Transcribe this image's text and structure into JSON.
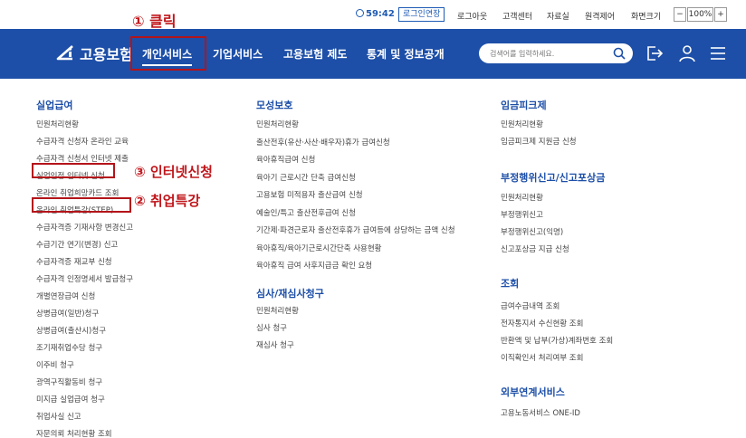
{
  "topbar": {
    "timer": "59:42",
    "extend": "로그인연장",
    "logout": "로그아웃",
    "support": "고객센터",
    "library": "자료실",
    "remote": "원격제어",
    "zoom_label": "화면크기",
    "zoom_minus": "−",
    "zoom_value": "100%",
    "zoom_plus": "+"
  },
  "nav": {
    "logo": "고용보험",
    "items": [
      "개인서비스",
      "기업서비스",
      "고용보험 제도",
      "통계 및 정보공개"
    ],
    "search_placeholder": "검색어를 입력하세요."
  },
  "annotations": {
    "a1": "① 클릭",
    "a2": "② 취업특강",
    "a3": "③ 인터넷신청"
  },
  "columns": {
    "c1": {
      "title": "실업급여",
      "items": [
        "민원처리현황",
        "수급자격 신청자 온라인 교육",
        "수급자격 신청서 인터넷 제출",
        "실업인정 인터넷 신청",
        "온라인 취업희망카드 조회",
        "온라인 취업특강(STEP)",
        "수급자격증 기재사항 변경신고",
        "수급기간 연기(변경) 신고",
        "수급자격증 재교부 신청",
        "수급자격 인정명세서 발급청구",
        "개별연장급여 신청",
        "상병급여(일반)청구",
        "상병급여(출산시)청구",
        "조기재취업수당 청구",
        "이주비 청구",
        "광역구직활동비 청구",
        "미지급 실업급여 청구",
        "취업사실 신고",
        "자문의뢰 처리현황 조회"
      ]
    },
    "c2": {
      "title": "모성보호",
      "items": [
        "민원처리현황",
        "출산전후(유산·사산·배우자)휴가 급여신청",
        "육아휴직급여 신청",
        "육아기 근로시간 단축 급여신청",
        "고용보험 미적용자 출산급여 신청",
        "예술인/특고 출산전후급여 신청",
        "기간제·파견근로자 출산전후휴가 급여등에 상당하는 금액 신청",
        "육아휴직/육아기근로시간단축 사용현황",
        "육아휴직 급여 사후지급금 확인 요청"
      ]
    },
    "c2b": {
      "title": "심사/재심사청구",
      "items": [
        "민원처리현황",
        "심사 청구",
        "재심사 청구"
      ]
    },
    "c3": {
      "title": "임금피크제",
      "items": [
        "민원처리현황",
        "임금피크제 지원금 신청"
      ]
    },
    "c3b": {
      "title": "부정행위신고/신고포상금",
      "items": [
        "민원처리현황",
        "부정행위신고",
        "부정행위신고(익명)",
        "신고포상금 지급 신청"
      ]
    },
    "c3c": {
      "title": "조회",
      "items": [
        "급여수급내역 조회",
        "전자통지서 수신현황 조회",
        "반환액 및 납부(가상)계좌번호 조회",
        "이직확인서 처리여부 조회"
      ]
    },
    "c3d": {
      "title": "외부연계서비스",
      "items": [
        "고용노동서비스 ONE-ID"
      ]
    }
  },
  "colors": {
    "nav_bg": "#1d4fa8",
    "accent": "#1e5ab4",
    "annotation_red": "#c0161b"
  }
}
